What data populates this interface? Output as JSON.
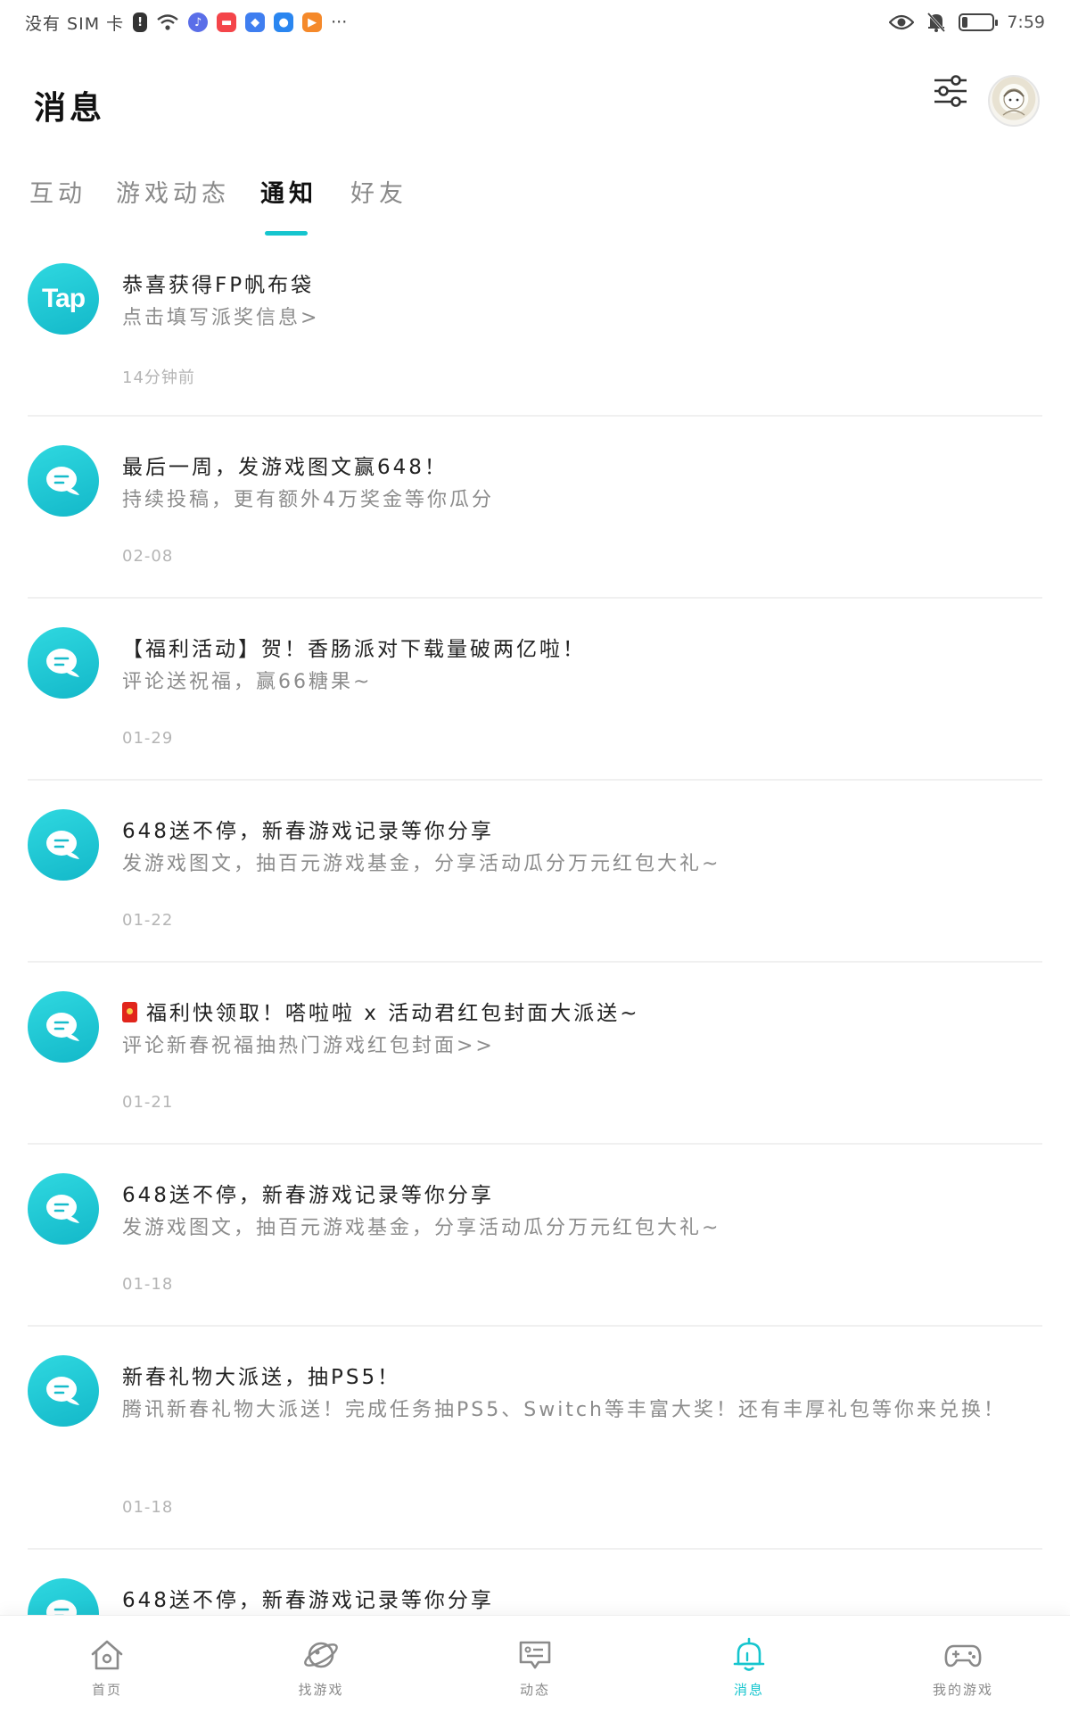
{
  "status_bar": {
    "carrier": "没有 SIM 卡",
    "time": "7:59",
    "more": "···"
  },
  "header": {
    "title": "消息"
  },
  "tabs": [
    {
      "label": "互动"
    },
    {
      "label": "游戏动态"
    },
    {
      "label": "通知",
      "active": true
    },
    {
      "label": "好友"
    }
  ],
  "notifications": [
    {
      "title": "恭喜获得FP帆布袋",
      "desc": "点击填写派奖信息>",
      "time": "14分钟前",
      "avatar": "Tap"
    },
    {
      "title": "最后一周，发游戏图文赢648！",
      "desc": "持续投稿，更有额外4万奖金等你瓜分",
      "time": "02-08"
    },
    {
      "title": "【福利活动】贺！香肠派对下载量破两亿啦！",
      "desc": "评论送祝福，赢66糖果~",
      "time": "01-29"
    },
    {
      "title": "648送不停，新春游戏记录等你分享",
      "desc": "发游戏图文，抽百元游戏基金，分享活动瓜分万元红包大礼~",
      "time": "01-22"
    },
    {
      "title": "福利快领取！嗒啦啦 x 活动君红包封面大派送~",
      "desc": "评论新春祝福抽热门游戏红包封面>>",
      "time": "01-21"
    },
    {
      "title": "648送不停，新春游戏记录等你分享",
      "desc": "发游戏图文，抽百元游戏基金，分享活动瓜分万元红包大礼~",
      "time": "01-18"
    },
    {
      "title": "新春礼物大派送，抽PS5！",
      "desc": "腾讯新春礼物大派送！完成任务抽PS5、Switch等丰富大奖！还有丰厚礼包等你来兑换！",
      "time": "01-18"
    },
    {
      "title": "648送不停，新春游戏记录等你分享",
      "desc": "",
      "time": ""
    }
  ],
  "bottom_nav": [
    {
      "label": "首页",
      "icon": "home-icon"
    },
    {
      "label": "找游戏",
      "icon": "planet-icon"
    },
    {
      "label": "动态",
      "icon": "feed-icon"
    },
    {
      "label": "消息",
      "icon": "bell-icon",
      "active": true
    },
    {
      "label": "我的游戏",
      "icon": "gamepad-icon"
    }
  ],
  "colors": {
    "accent": "#15c5ce",
    "avatar_gradient_start": "#2fd8e0",
    "avatar_gradient_end": "#13b8c9",
    "muted_text": "#8c8c8c",
    "time_text": "#b5b5b5"
  }
}
